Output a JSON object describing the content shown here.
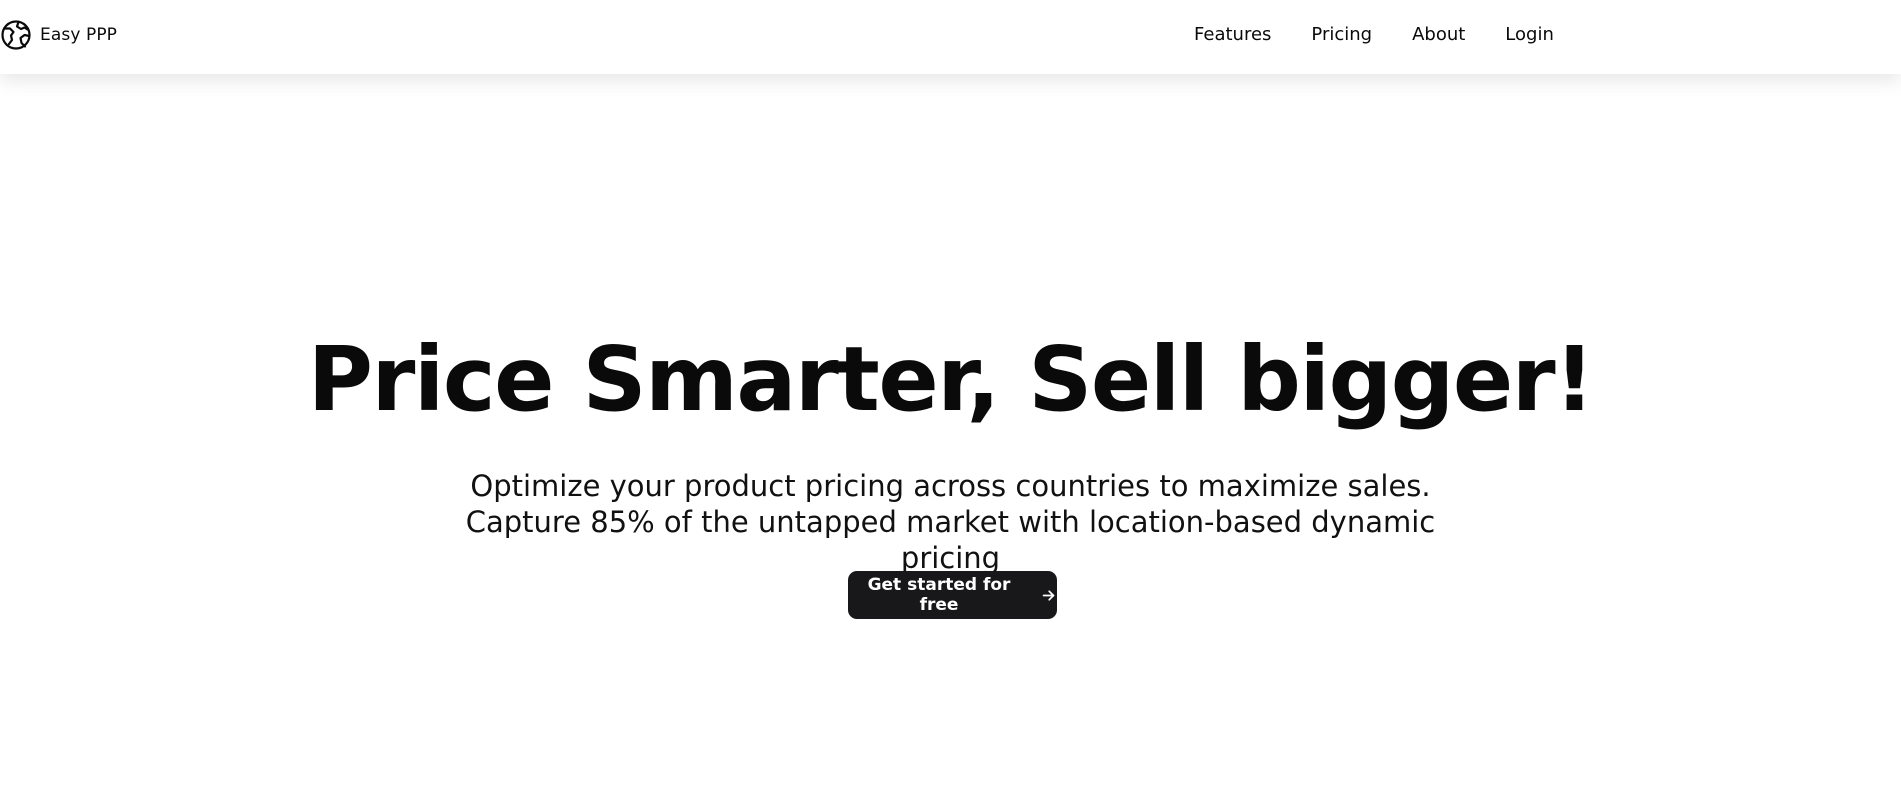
{
  "header": {
    "brand_name": "Easy PPP",
    "brand_icon": "globe-logo-icon",
    "nav": [
      {
        "label": "Features"
      },
      {
        "label": "Pricing"
      },
      {
        "label": "About"
      },
      {
        "label": "Login"
      }
    ]
  },
  "hero": {
    "title": "Price Smarter, Sell bigger!",
    "subtitle": "Optimize your product pricing across countries to maximize sales. Capture 85% of the untapped market with location-based dynamic pricing",
    "cta_label": "Get started for free",
    "cta_icon": "arrow-right-icon"
  },
  "colors": {
    "text": "#0a0a0a",
    "button_bg": "#18181b",
    "button_text": "#ffffff",
    "background": "#ffffff"
  }
}
